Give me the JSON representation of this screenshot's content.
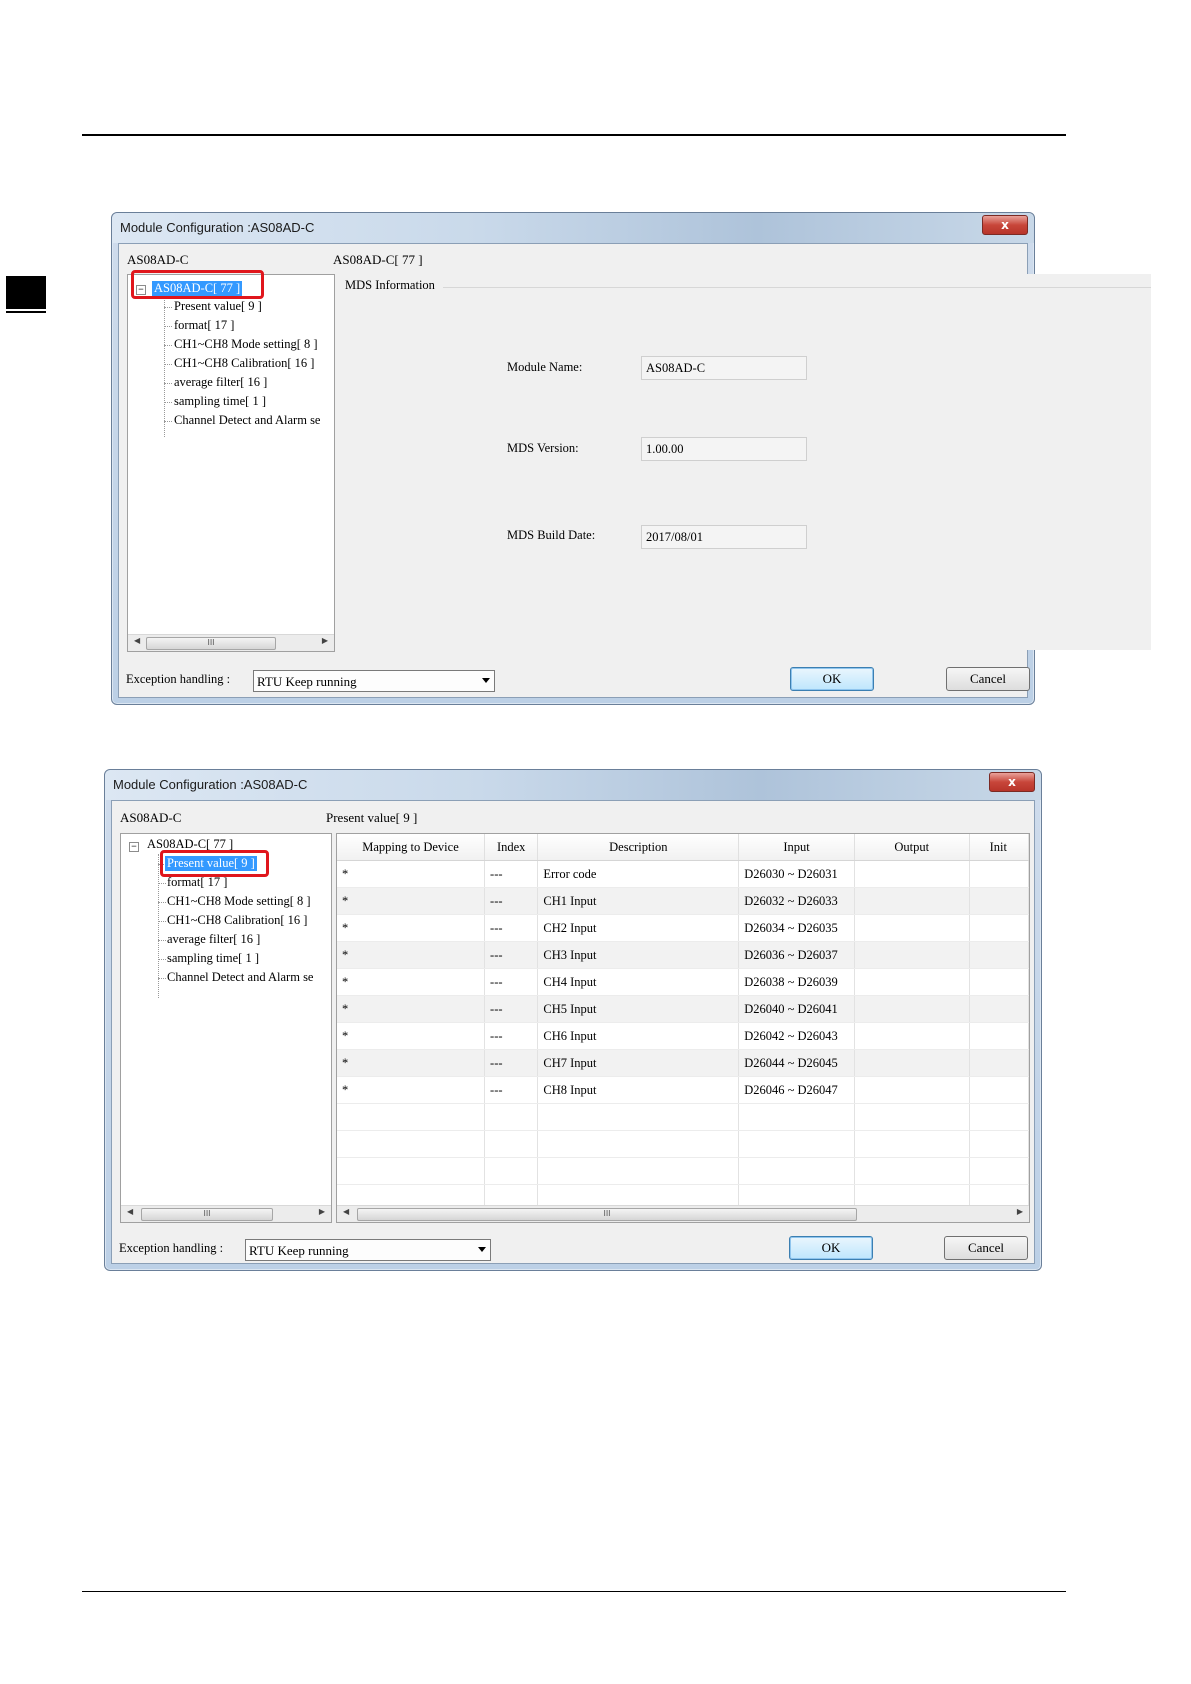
{
  "window_title": "Module Configuration :AS08AD-C",
  "close_glyph": "x",
  "tree_header": "AS08AD-C",
  "tree": {
    "root": "AS08AD-C[ 77 ]",
    "children": [
      "Present value[ 9 ]",
      "format[ 17 ]",
      "CH1~CH8 Mode setting[ 8 ]",
      "CH1~CH8 Calibration[ 16 ]",
      "average filter[ 16 ]",
      "sampling time[ 1 ]",
      "Channel Detect and Alarm se"
    ]
  },
  "scroll_grip": "III",
  "dialog1": {
    "panel_header": "AS08AD-C[ 77 ]",
    "group_title": "MDS Information",
    "module_name_label": "Module Name:",
    "module_name_value": "AS08AD-C",
    "mds_version_label": "MDS Version:",
    "mds_version_value": "1.00.00",
    "mds_build_date_label": "MDS Build Date:",
    "mds_build_date_value": "2017/08/01"
  },
  "dialog2": {
    "panel_header": "Present value[ 9 ]",
    "columns": [
      "Mapping to Device",
      "Index",
      "Description",
      "Input",
      "Output",
      "Init"
    ],
    "rows": [
      {
        "mapping": "*",
        "index": "---",
        "description": "Error code",
        "input": "D26030 ~ D26031",
        "output": ""
      },
      {
        "mapping": "*",
        "index": "---",
        "description": "CH1 Input",
        "input": "D26032 ~ D26033",
        "output": ""
      },
      {
        "mapping": "*",
        "index": "---",
        "description": "CH2 Input",
        "input": "D26034 ~ D26035",
        "output": ""
      },
      {
        "mapping": "*",
        "index": "---",
        "description": "CH3 Input",
        "input": "D26036 ~ D26037",
        "output": ""
      },
      {
        "mapping": "*",
        "index": "---",
        "description": "CH4 Input",
        "input": "D26038 ~ D26039",
        "output": ""
      },
      {
        "mapping": "*",
        "index": "---",
        "description": "CH5 Input",
        "input": "D26040 ~ D26041",
        "output": ""
      },
      {
        "mapping": "*",
        "index": "---",
        "description": "CH6 Input",
        "input": "D26042 ~ D26043",
        "output": ""
      },
      {
        "mapping": "*",
        "index": "---",
        "description": "CH7 Input",
        "input": "D26044 ~ D26045",
        "output": ""
      },
      {
        "mapping": "*",
        "index": "---",
        "description": "CH8 Input",
        "input": "D26046 ~ D26047",
        "output": ""
      }
    ]
  },
  "footer": {
    "exception_label": "Exception handling :",
    "exception_value": "RTU Keep running",
    "ok": "OK",
    "cancel": "Cancel"
  },
  "colors": {
    "selection": "#3399ff",
    "highlight_box": "#e0161c",
    "close_button": "#c8463a"
  }
}
